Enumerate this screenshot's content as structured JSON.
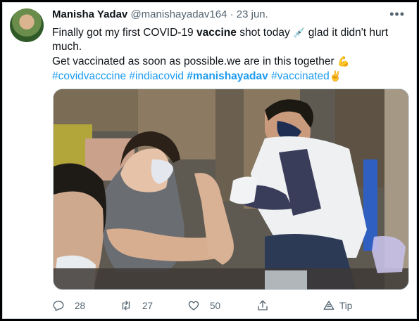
{
  "tweet": {
    "author_name": "Manisha Yadav",
    "handle": "@manishayadav164",
    "separator": "·",
    "date": "23 jun.",
    "more_icon": "more-icon",
    "line1_pre": "Finally got my first COVID-19 ",
    "line1_bold": "vaccine",
    "line1_post": " shot today",
    "syringe_emoji": "💉",
    "line1_end": "  glad it didn't hurt much.",
    "line2": "Get vaccinated as soon as possible.we are in this together",
    "muscle_emoji": "💪",
    "hashtags": [
      {
        "text": "#covidvacccine",
        "bold": false
      },
      {
        "text": "#indiacovid",
        "bold": false
      },
      {
        "text": "#manishayadav",
        "bold": true
      },
      {
        "text": "#vaccinated",
        "bold": false
      }
    ],
    "victory_emoji": "✌"
  },
  "actions": {
    "reply_count": "28",
    "retweet_count": "27",
    "like_count": "50",
    "tip_label": "Tip"
  },
  "colors": {
    "link": "#1d9bf0",
    "text": "#0f1419",
    "muted": "#536471"
  }
}
